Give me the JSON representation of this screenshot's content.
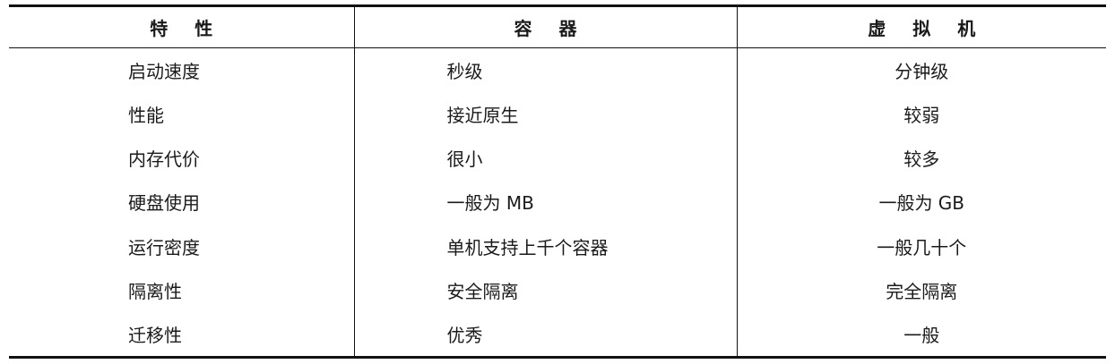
{
  "table": {
    "headers": [
      "特性",
      "容器",
      "虚拟机"
    ],
    "rows": [
      [
        "启动速度",
        "秒级",
        "分钟级"
      ],
      [
        "性能",
        "接近原生",
        "较弱"
      ],
      [
        "内存代价",
        "很小",
        "较多"
      ],
      [
        "硬盘使用",
        "一般为 MB",
        "一般为 GB"
      ],
      [
        "运行密度",
        "单机支持上千个容器",
        "一般几十个"
      ],
      [
        "隔离性",
        "安全隔离",
        "完全隔离"
      ],
      [
        "迁移性",
        "优秀",
        "一般"
      ]
    ]
  }
}
